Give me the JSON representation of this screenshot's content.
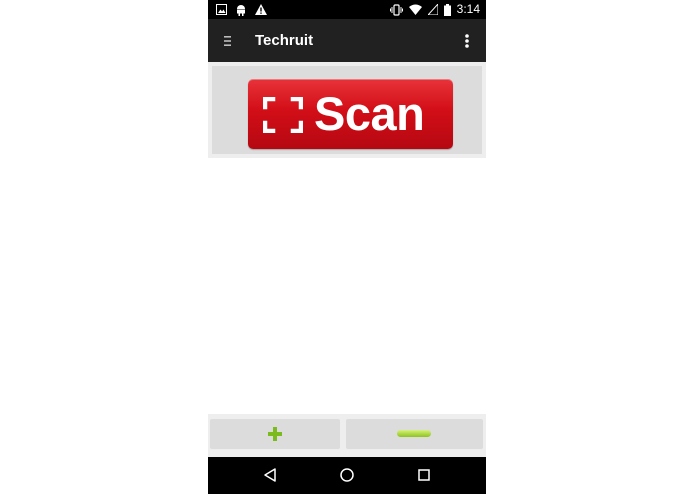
{
  "status_bar": {
    "time": "3:14",
    "left_icons": [
      "image-notification-icon",
      "android-debug-icon",
      "warning-icon"
    ],
    "right_icons": [
      "vibrate-icon",
      "wifi-icon",
      "cellular-signal-icon",
      "battery-icon"
    ]
  },
  "app_bar": {
    "title": "Techruit",
    "nav_icon": "drawer-menu-icon",
    "overflow_icon": "overflow-menu-icon"
  },
  "scan": {
    "label": "Scan",
    "icon": "scan-frame-icon",
    "color": "#d20e17"
  },
  "controls": {
    "add_icon": "plus-icon",
    "remove_icon": "minus-icon",
    "accent_color": "#7cbb1e"
  },
  "nav_bar": {
    "icons": [
      "back-icon",
      "home-icon",
      "recents-icon"
    ]
  }
}
